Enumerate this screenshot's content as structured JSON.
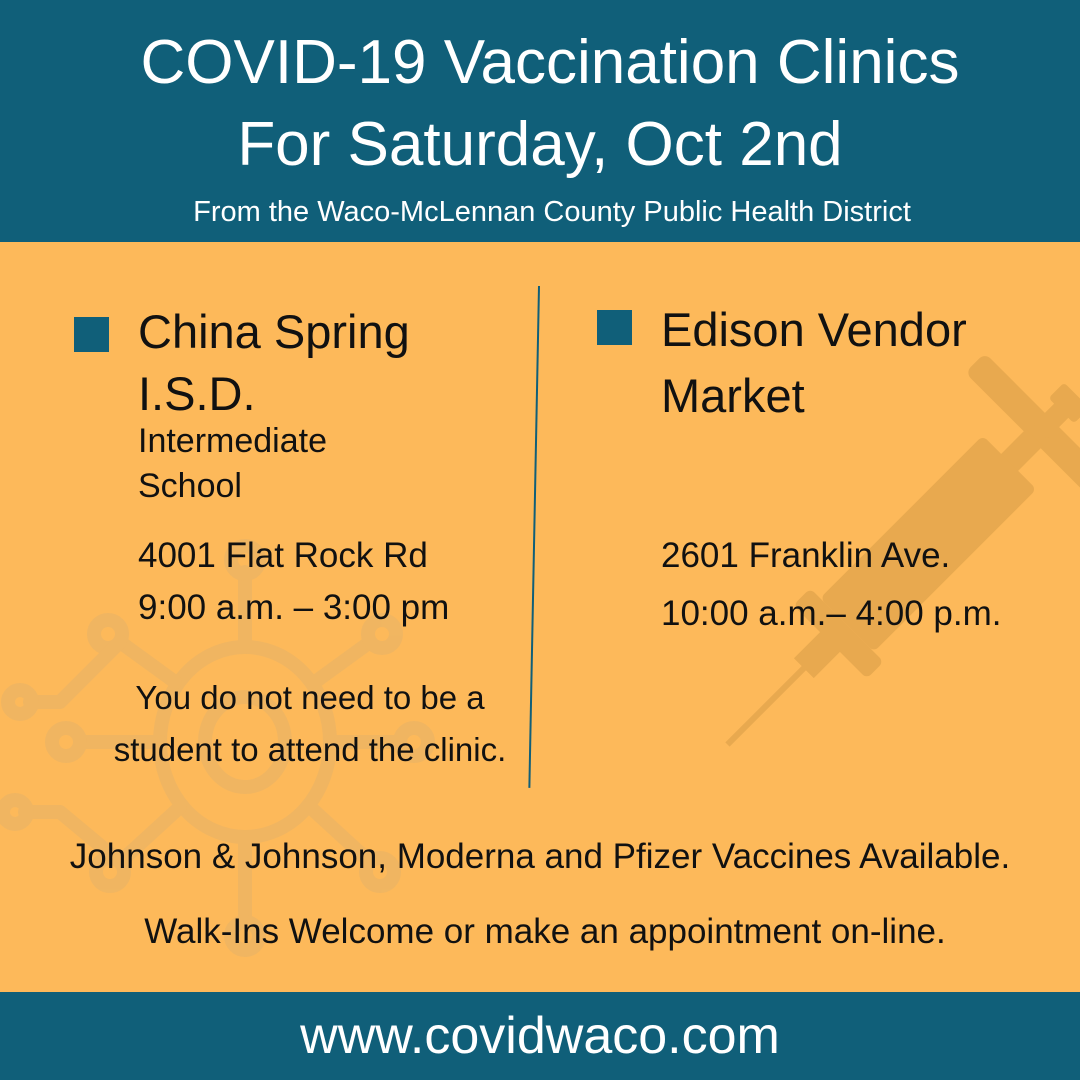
{
  "header": {
    "title_line1": "COVID-19 Vaccination Clinics",
    "title_line2": "For Saturday, Oct 2nd",
    "subtitle": "From the Waco-McLennan County Public Health District"
  },
  "clinics": [
    {
      "name_line1": "China Spring",
      "name_line2": "I.S.D.",
      "sub_line1": "Intermediate",
      "sub_line2": "School",
      "address": "4001 Flat Rock Rd",
      "hours": "9:00 a.m. – 3:00 pm",
      "note_line1": "You do not need to be a",
      "note_line2": "student to attend the clinic."
    },
    {
      "name_line1": "Edison Vendor",
      "name_line2": "Market",
      "address": "2601 Franklin Ave.",
      "hours": "10:00 a.m.– 4:00 p.m."
    }
  ],
  "vaccines_text": "Johnson & Johnson, Moderna and Pfizer Vaccines Available.",
  "walkins_text": "Walk-Ins Welcome or make an appointment on-line.",
  "footer": {
    "url": "www.covidwaco.com"
  },
  "colors": {
    "teal": "#105f79",
    "orange": "#fdb95a",
    "decor": "#e9a84f"
  },
  "icons": [
    "virus-icon",
    "syringe-icon"
  ]
}
